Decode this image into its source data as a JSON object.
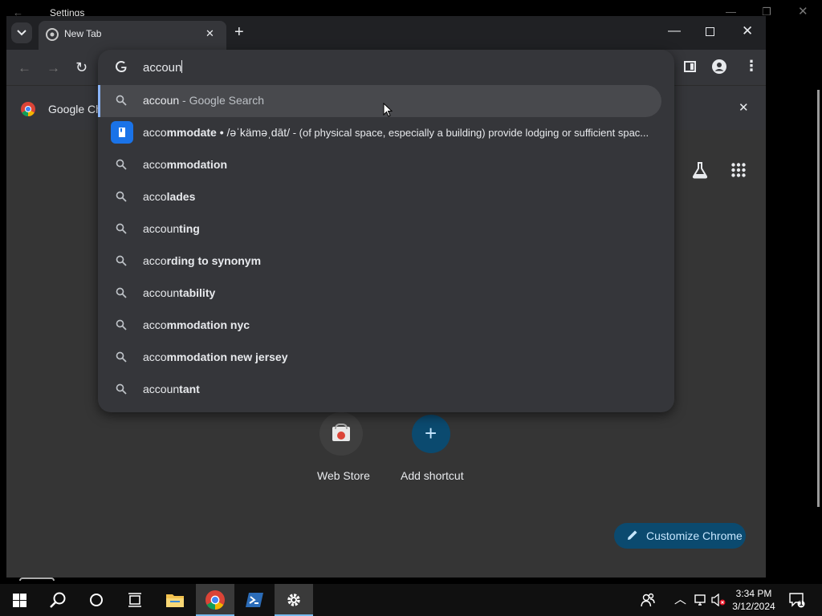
{
  "background_window": {
    "title": "Settings"
  },
  "browser": {
    "tab_title": "New Tab",
    "infobar_label": "Google Ch"
  },
  "omnibox": {
    "input_value": "accoun",
    "suggestions": [
      {
        "plain": "accoun",
        "bold": "",
        "suffix": " - Google Search",
        "type": "search"
      },
      {
        "plain": "acco",
        "bold": "mmodate",
        "suffix": "",
        "type": "answer",
        "answer_sep": " • ",
        "phonetic": "/əˈkäməˌdāt/",
        "definition": " - (of physical space, especially a building) provide lodging or sufficient spac..."
      },
      {
        "plain": "acco",
        "bold": "mmodation",
        "suffix": "",
        "type": "search"
      },
      {
        "plain": "acco",
        "bold": "lades",
        "suffix": "",
        "type": "search"
      },
      {
        "plain": "accoun",
        "bold": "ting",
        "suffix": "",
        "type": "search"
      },
      {
        "plain": "acco",
        "bold": "rding to synonym",
        "suffix": "",
        "type": "search"
      },
      {
        "plain": "accoun",
        "bold": "tability",
        "suffix": "",
        "type": "search"
      },
      {
        "plain": "acco",
        "bold": "mmodation nyc",
        "suffix": "",
        "type": "search"
      },
      {
        "plain": "acco",
        "bold": "mmodation new jersey",
        "suffix": "",
        "type": "search"
      },
      {
        "plain": "accoun",
        "bold": "tant",
        "suffix": "",
        "type": "search"
      }
    ]
  },
  "ntp": {
    "shortcuts": [
      {
        "label": "Web Store"
      },
      {
        "label": "Add shortcut"
      }
    ],
    "customize_label": "Customize Chrome"
  },
  "taskbar": {
    "time": "3:34 PM",
    "date": "3/12/2024",
    "notification_count": "1"
  },
  "colors": {
    "accent_blue": "#8ab4f8",
    "customize_bg": "#0b4a6f",
    "chrome_bg": "#202124",
    "surface": "#35363a"
  }
}
